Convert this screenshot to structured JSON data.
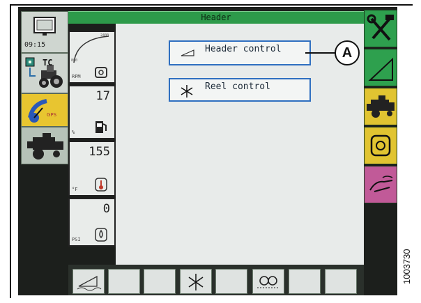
{
  "screen": {
    "title": "Header"
  },
  "status": {
    "time": "09:15",
    "tc_label": "TC"
  },
  "gauges": [
    {
      "name": "rpm",
      "value": "",
      "unit": "RPM",
      "scale_max": "2400",
      "scale_min": "800"
    },
    {
      "name": "fuel",
      "value": "17",
      "unit": "%"
    },
    {
      "name": "coolant-temp",
      "value": "155",
      "unit": "°F"
    },
    {
      "name": "oil-pressure",
      "value": "0",
      "unit": "PSI"
    }
  ],
  "menu": {
    "header_control_label": "Header control",
    "reel_control_label": "Reel control"
  },
  "gps_label": "GPS",
  "callout_label": "A",
  "figure_id": "1003730",
  "colors": {
    "title_bar": "#2d9a4a",
    "button_border": "#2f6fc0",
    "gps_tile": "#e8c530",
    "right_green": "#2ea04e",
    "right_yellow": "#e1c431",
    "right_purple": "#c15a98"
  },
  "icons": {
    "clock": "monitor-icon",
    "tractor": "tractor-icon",
    "gps": "gps-satellite-icon",
    "combine": "combine-icon",
    "header": "header-wedge-icon",
    "reel": "reel-star-icon",
    "tools": "wrench-hammer-icon",
    "engine": "engine-icon",
    "hand": "hand-icon"
  }
}
